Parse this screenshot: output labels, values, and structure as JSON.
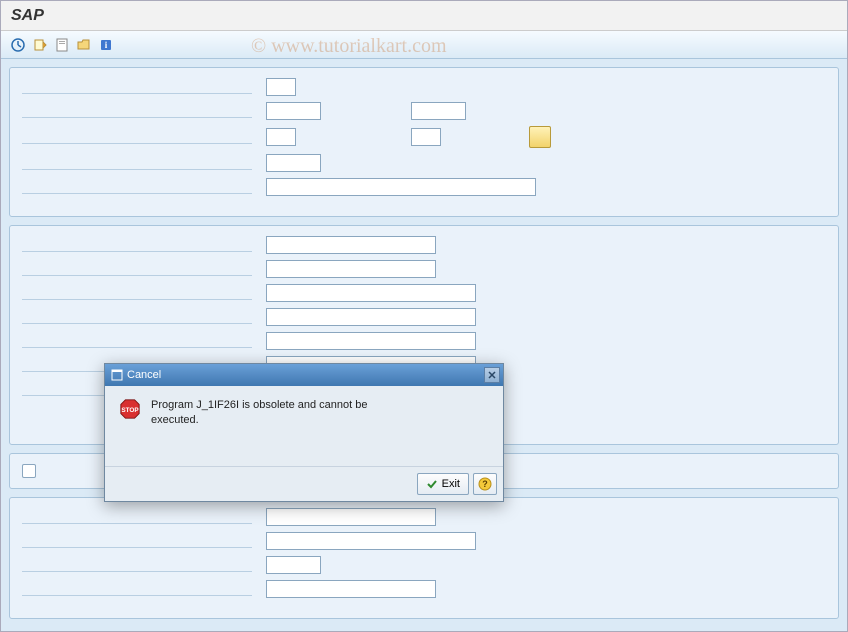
{
  "window_title": "SAP",
  "watermark": "©  www.tutorialkart.com",
  "toolbar": {
    "execute": "execute-icon",
    "get_variant": "get-variant-icon",
    "new": "new-icon",
    "open": "open-icon",
    "info": "info-icon"
  },
  "dialog": {
    "title": "Cancel",
    "message": "Program J_1IF26I is obsolete and cannot be executed.",
    "exit_label": "Exit"
  }
}
